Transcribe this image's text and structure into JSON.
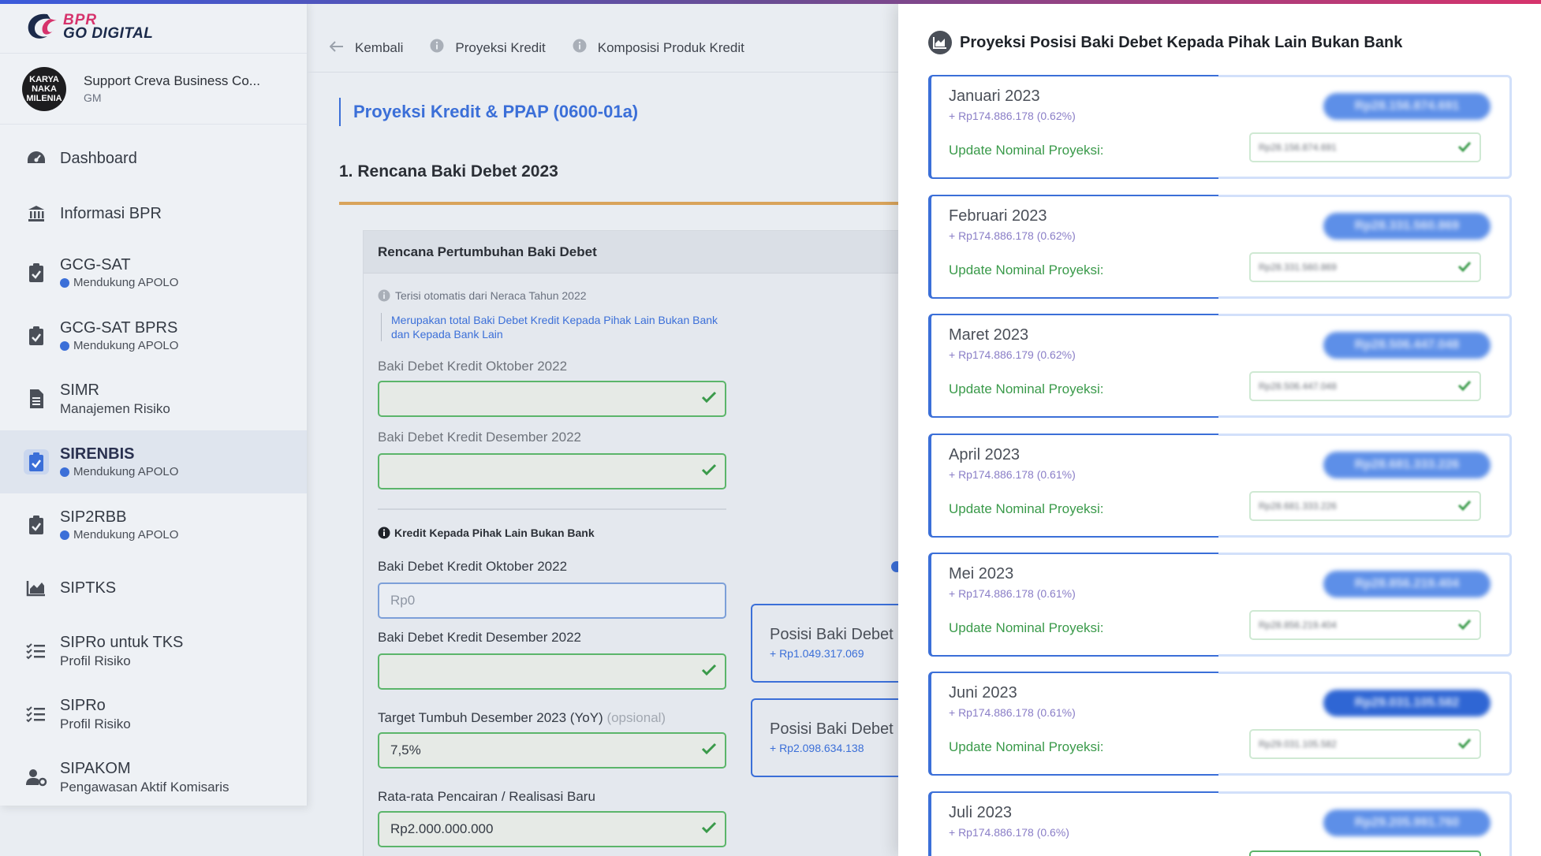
{
  "brand": {
    "line1": "BPR",
    "line2": "GO DIGITAL"
  },
  "profile": {
    "avatar_text": "KARYA NAKA MILENIA",
    "name": "Support Creva Business Co...",
    "role": "GM"
  },
  "sidebar": {
    "items": [
      {
        "label": "Dashboard",
        "sub": "",
        "icon": "dashboard-icon"
      },
      {
        "label": "Informasi BPR",
        "sub": "",
        "icon": "bank-icon"
      },
      {
        "label": "GCG-SAT",
        "sub": "Mendukung APOLO",
        "icon": "clipboard-check-icon"
      },
      {
        "label": "GCG-SAT BPRS",
        "sub": "Mendukung APOLO",
        "icon": "clipboard-check-icon"
      },
      {
        "label": "SIMR",
        "sub": "Manajemen Risiko",
        "icon": "document-icon"
      },
      {
        "label": "SIRENBIS",
        "sub": "Mendukung APOLO",
        "icon": "clipboard-check-icon"
      },
      {
        "label": "SIP2RBB",
        "sub": "Mendukung APOLO",
        "icon": "clipboard-check-icon"
      },
      {
        "label": "SIPTKS",
        "sub": "",
        "icon": "area-chart-icon"
      },
      {
        "label": "SIPRo untuk TKS",
        "sub": "Profil Risiko",
        "icon": "checklist-icon"
      },
      {
        "label": "SIPRo",
        "sub": "Profil Risiko",
        "icon": "checklist-icon"
      },
      {
        "label": "SIPAKOM",
        "sub": "Pengawasan Aktif Komisaris",
        "icon": "user-gear-icon"
      }
    ]
  },
  "subnav": {
    "back": "Kembali",
    "tab1": "Proyeksi Kredit",
    "tab2": "Komposisi Produk Kredit"
  },
  "main": {
    "page_title": "Proyeksi Kredit & PPAP (0600-01a)",
    "section_title": "1. Rencana Baki Debet 2023",
    "card_title": "Rencana Pertumbuhan Baki Debet",
    "auto_note": "Terisi otomatis dari Neraca Tahun 2022",
    "info_note": "Merupakan total Baki Debet Kredit Kepada Pihak Lain Bukan Bank dan Kepada Bank Lain",
    "label_okt_1": "Baki Debet Kredit Oktober 2022",
    "label_des_1": "Baki Debet Kredit Desember 2022",
    "kredit_title": "Kredit Kepada Pihak Lain Bukan Bank",
    "label_okt_2": "Baki Debet Kredit Oktober 2022",
    "okt_2_placeholder": "Rp0",
    "label_des_2": "Baki Debet Kredit Desember 2022",
    "label_target": "Target Tumbuh Desember 2023 (YoY)",
    "label_target_opt": "(opsional)",
    "target_value": "7,5%",
    "label_rata": "Rata-rata Pencairan / Realisasi Baru",
    "rata_value": "Rp2.000.000.000",
    "pos1_title": "Posisi Baki Debet",
    "pos1_value": "+ Rp1.049.317.069",
    "pos2_title": "Posisi Baki Debet",
    "pos2_value": "+ Rp2.098.634.138"
  },
  "panel": {
    "title": "Proyeksi Posisi Baki Debet Kepada Pihak Lain Bukan Bank",
    "update_label": "Update Nominal Proyeksi:",
    "months": [
      {
        "name": "Januari 2023",
        "delta": "+ Rp174.886.178 (0.62%)",
        "pill": "Rp28.156.874.691",
        "input": "Rp28.156.874.691"
      },
      {
        "name": "Februari 2023",
        "delta": "+ Rp174.886.178 (0.62%)",
        "pill": "Rp28.331.560.869",
        "input": "Rp28.331.560.869"
      },
      {
        "name": "Maret 2023",
        "delta": "+ Rp174.886.179 (0.62%)",
        "pill": "Rp28.506.447.048",
        "input": "Rp28.506.447.048"
      },
      {
        "name": "April 2023",
        "delta": "+ Rp174.886.178 (0.61%)",
        "pill": "Rp28.681.333.226",
        "input": "Rp28.681.333.226"
      },
      {
        "name": "Mei 2023",
        "delta": "+ Rp174.886.178 (0.61%)",
        "pill": "Rp28.856.219.404",
        "input": "Rp28.856.219.404"
      },
      {
        "name": "Juni 2023",
        "delta": "+ Rp174.886.178 (0.61%)",
        "pill": "Rp29.031.105.582",
        "input": "Rp29.031.105.582"
      },
      {
        "name": "Juli 2023",
        "delta": "+ Rp174.886.178 (0.6%)",
        "pill": "Rp29.205.991.760",
        "input": ""
      }
    ]
  },
  "colors": {
    "accent": "#3b6fd8",
    "success": "#3a9a4a",
    "delta": "#8a7ec7",
    "brand_red": "#d6336c"
  }
}
